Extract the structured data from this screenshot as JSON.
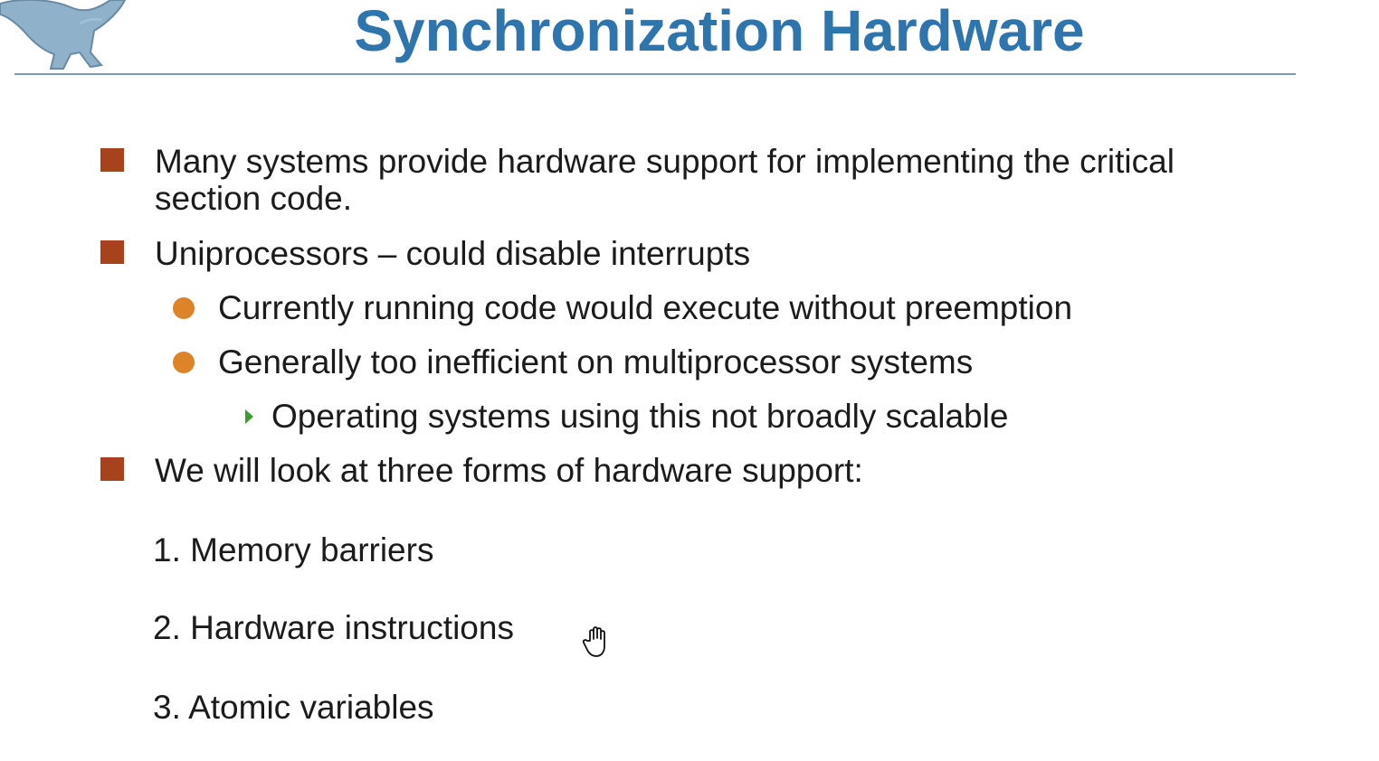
{
  "slide": {
    "title": "Synchronization Hardware",
    "bullets": [
      {
        "text": "Many systems provide hardware support for implementing the critical section code."
      },
      {
        "text": "Uniprocessors – could disable interrupts"
      },
      {
        "text": "We will look at three forms of hardware support:"
      }
    ],
    "sub_bullets": [
      {
        "text": "Currently running code would execute without preemption"
      },
      {
        "text": "Generally too inefficient on multiprocessor systems"
      }
    ],
    "sub_sub_bullets": [
      {
        "text": "Operating systems using this not broadly scalable"
      }
    ],
    "numbered_items": [
      {
        "text": "1. Memory barriers"
      },
      {
        "text": "2. Hardware instructions"
      },
      {
        "text": "3. Atomic variables"
      }
    ]
  },
  "colors": {
    "title": "#2e74ad",
    "title_rule": "#7a99b8",
    "square_bullet": "#a6431c",
    "dot_bullet": "#dd8428",
    "arrow_bullet": "#3a9b2e",
    "body_text": "#1b1b1b"
  },
  "icons": {
    "logo": "dinosaur-logo-icon",
    "cursor": "hand-pointer-cursor-icon"
  }
}
